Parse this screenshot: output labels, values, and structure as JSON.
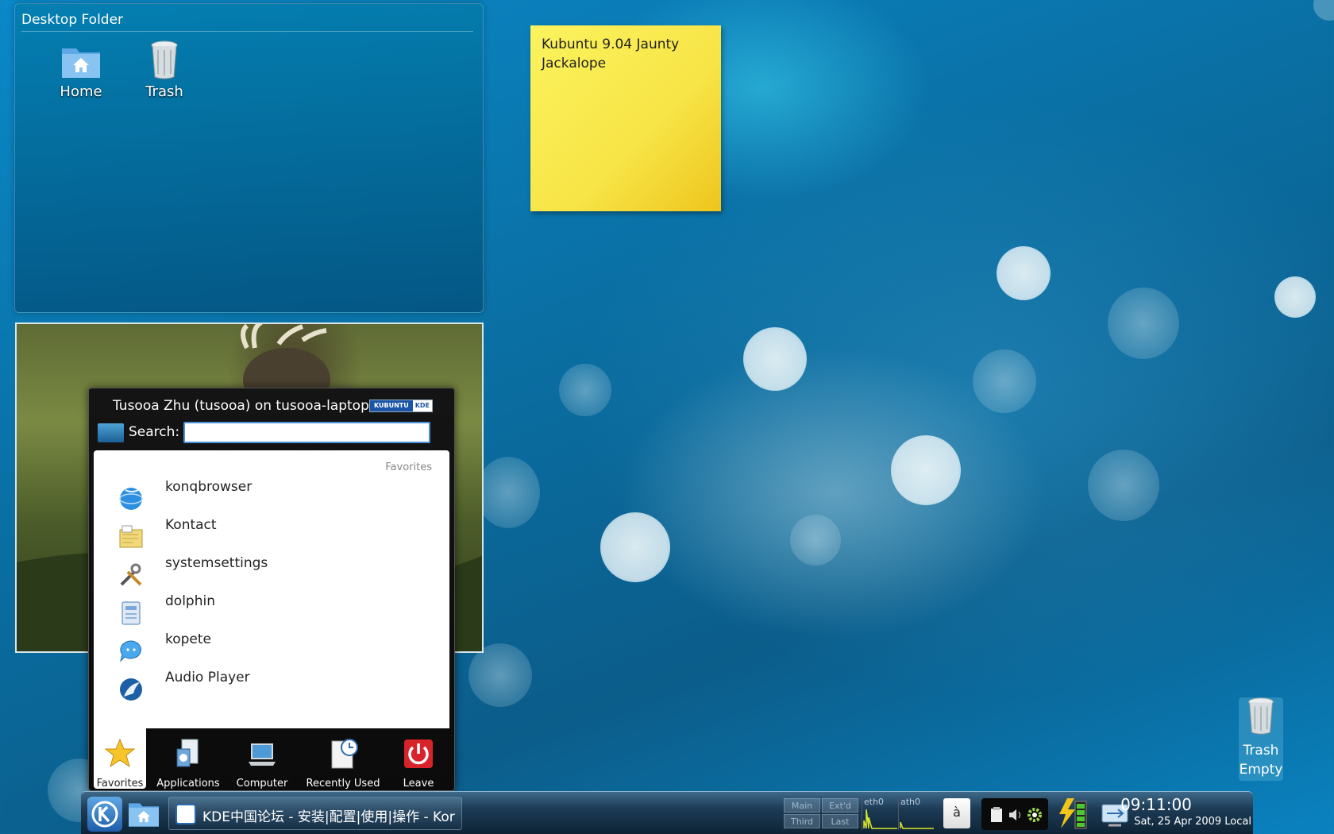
{
  "folder_view": {
    "title": "Desktop Folder",
    "icons": [
      {
        "label": "Home",
        "icon": "home-folder-icon"
      },
      {
        "label": "Trash",
        "icon": "trash-icon"
      }
    ]
  },
  "note": {
    "line1": "Kubuntu 9.04 Jaunty",
    "line2": "Jackalope"
  },
  "kickoff": {
    "user_line": "Tusooa Zhu (tusooa) on tusooa-laptop",
    "logo_left": "KUBUNTU",
    "logo_right": "KDE",
    "search_label": "Search:",
    "search_value": "",
    "section_header": "Favorites",
    "favorites": [
      {
        "label": "konqbrowser",
        "icon": "globe-icon"
      },
      {
        "label": "Kontact",
        "icon": "contacts-icon"
      },
      {
        "label": "systemsettings",
        "icon": "tools-icon"
      },
      {
        "label": "dolphin",
        "icon": "file-manager-icon"
      },
      {
        "label": "kopete",
        "icon": "chat-icon"
      },
      {
        "label": "Audio Player",
        "icon": "audio-player-icon"
      }
    ],
    "tabs": [
      {
        "label": "Favorites",
        "icon": "star-icon",
        "active": true
      },
      {
        "label": "Applications",
        "icon": "applications-icon",
        "active": false
      },
      {
        "label": "Computer",
        "icon": "computer-icon",
        "active": false
      },
      {
        "label": "Recently Used",
        "icon": "recent-icon",
        "active": false
      },
      {
        "label": "Leave",
        "icon": "power-icon",
        "active": false
      }
    ]
  },
  "trash_widget": {
    "line1": "Trash",
    "line2": "Empty"
  },
  "panel": {
    "task_title": "KDE中国论坛 - 安装|配置|使用|操作 - Kor",
    "pager": [
      "Main",
      "Ext'd",
      "Third",
      "Last"
    ],
    "net_labels": [
      "eth0",
      "ath0"
    ],
    "keyboard_layout": "à",
    "clock_time": "09:11:00",
    "clock_date": "Sat, 25 Apr 2009 Local"
  },
  "colors": {
    "accent": "#4a90d9",
    "note_yellow": "#f7e446",
    "power_red": "#d8232a"
  }
}
